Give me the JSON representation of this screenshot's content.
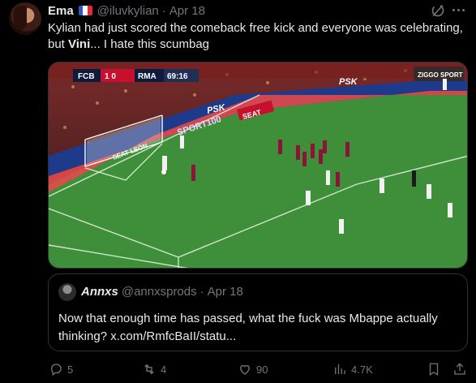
{
  "tweet": {
    "author_name": "Ema",
    "handle": "@iluvkylian",
    "separator": "·",
    "date": "Apr 18",
    "text_before": "Kylian had just scored the comeback free kick and everyone was celebrating, but ",
    "text_bold": "Vini",
    "text_after": "... I hate this scumbag"
  },
  "media": {
    "scoreboard": {
      "home": "FCB",
      "score": "1  0",
      "away": "RMA",
      "clock": "69:16"
    },
    "ad_boards": [
      "PSK",
      "SPORT100",
      "SEAT LEÓN",
      "SEAT",
      "PSK",
      "ZIGGO SPORT"
    ]
  },
  "quote": {
    "author_name": "Annxs",
    "handle": "@annxsprods",
    "separator": "·",
    "date": "Apr 18",
    "text": "Now that enough time has passed, what the fuck was Mbappe actually thinking? x.com/RmfcBaII/statu..."
  },
  "actions": {
    "replies": "5",
    "reposts": "4",
    "likes": "90",
    "views": "4.7K"
  },
  "colors": {
    "accent": "#1d9bf0",
    "muted": "#71767b",
    "pitch": "#3f8f3a",
    "barca_red": "#a50044",
    "barca_blue": "#004d98"
  }
}
